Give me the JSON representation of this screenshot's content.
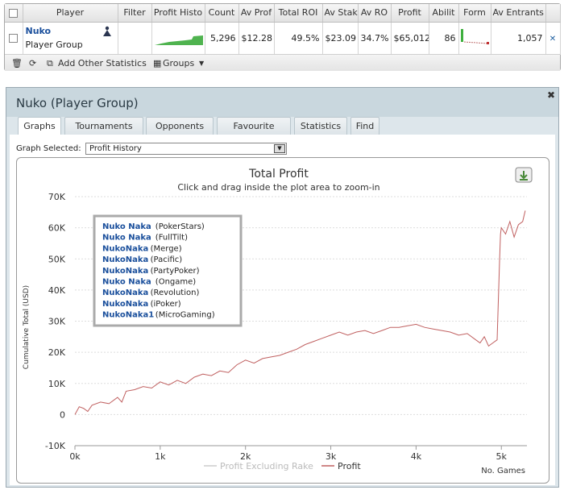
{
  "grid": {
    "headers": [
      "Player",
      "Filter",
      "Profit Histo",
      "Count",
      "Av Prof",
      "Total ROI",
      "Av Stak",
      "Av RO",
      "Profit",
      "Abilit",
      "Form",
      "Av Entrants"
    ],
    "row": {
      "player_name": "Nuko",
      "player_sub": "Player Group",
      "count": "5,296",
      "av_profit": "$12.28",
      "total_roi": "49.5%",
      "av_stake": "$23.09",
      "av_roi": "34.7%",
      "profit": "$65,012",
      "ability": "86",
      "av_entrants": "1,057"
    },
    "toolbar": {
      "add_stats": "Add Other Statistics",
      "groups": "Groups"
    }
  },
  "panel": {
    "title": "Nuko (Player Group)",
    "tabs": [
      "Graphs",
      "Tournaments",
      "Opponents",
      "Favourite Games",
      "Statistics",
      "Find"
    ],
    "active_tab": "Graphs",
    "graph_selected_label": "Graph Selected:",
    "graph_selected_value": "Profit History"
  },
  "colors": {
    "profit_line": "#c06060",
    "rake_line": "#cccccc",
    "link": "#1a4f9c"
  },
  "chart_data": {
    "type": "line",
    "title": "Total Profit",
    "subtitle": "Click and drag inside the plot area to zoom-in",
    "ylabel": "Cumulative Total (USD)",
    "xlabel": "No. Games",
    "ylim": [
      -10000,
      70000
    ],
    "xlim": [
      0,
      5300
    ],
    "yticks": [
      "-10K",
      "0",
      "10K",
      "20K",
      "30K",
      "40K",
      "50K",
      "60K",
      "70K"
    ],
    "ytick_values": [
      -10000,
      0,
      10000,
      20000,
      30000,
      40000,
      50000,
      60000,
      70000
    ],
    "xticks": [
      "0k",
      "1k",
      "2k",
      "3k",
      "4k",
      "5k"
    ],
    "xtick_values": [
      0,
      1000,
      2000,
      3000,
      4000,
      5000
    ],
    "grid": true,
    "legend": [
      {
        "name": "Profit Excluding Rake",
        "color": "#cccccc"
      },
      {
        "name": "Profit",
        "color": "#c06060"
      }
    ],
    "annotation_box": [
      {
        "player": "Nuko Naka",
        "site": "(PokerStars)"
      },
      {
        "player": "Nuko Naka",
        "site": "(FullTilt)"
      },
      {
        "player": "NukoNaka",
        "site": "(Merge)"
      },
      {
        "player": "NukoNaka",
        "site": "(Pacific)"
      },
      {
        "player": "NukoNaka",
        "site": "(PartyPoker)"
      },
      {
        "player": "Nuko Naka",
        "site": "(Ongame)"
      },
      {
        "player": "NukoNaka",
        "site": "(Revolution)"
      },
      {
        "player": "NukoNaka",
        "site": "(iPoker)"
      },
      {
        "player": "NukoNaka1",
        "site": "(MicroGaming)"
      }
    ],
    "series": [
      {
        "name": "Profit",
        "x": [
          0,
          50,
          100,
          150,
          200,
          300,
          400,
          500,
          550,
          600,
          700,
          800,
          900,
          1000,
          1100,
          1200,
          1300,
          1400,
          1500,
          1600,
          1700,
          1800,
          1900,
          2000,
          2100,
          2200,
          2300,
          2400,
          2500,
          2600,
          2700,
          2800,
          2900,
          3000,
          3100,
          3200,
          3300,
          3400,
          3500,
          3600,
          3700,
          3800,
          3900,
          4000,
          4100,
          4200,
          4300,
          4400,
          4500,
          4600,
          4700,
          4750,
          4800,
          4850,
          4900,
          4950,
          4980,
          4990,
          5000,
          5050,
          5100,
          5150,
          5200,
          5250,
          5280
        ],
        "y": [
          0,
          2500,
          2000,
          1000,
          3000,
          4000,
          3500,
          5500,
          4000,
          7500,
          8000,
          9000,
          8500,
          10500,
          9500,
          11000,
          10000,
          12000,
          13000,
          12500,
          14000,
          13500,
          16000,
          17500,
          16500,
          18000,
          18500,
          19000,
          20000,
          21000,
          22500,
          23500,
          24500,
          25500,
          26500,
          25500,
          26500,
          27000,
          26000,
          27000,
          28000,
          28000,
          28500,
          29000,
          28000,
          27500,
          27000,
          26500,
          25500,
          26000,
          24000,
          23000,
          25000,
          22000,
          23000,
          24000,
          50000,
          58000,
          60000,
          58000,
          62000,
          57000,
          61000,
          62000,
          65500
        ]
      }
    ]
  }
}
